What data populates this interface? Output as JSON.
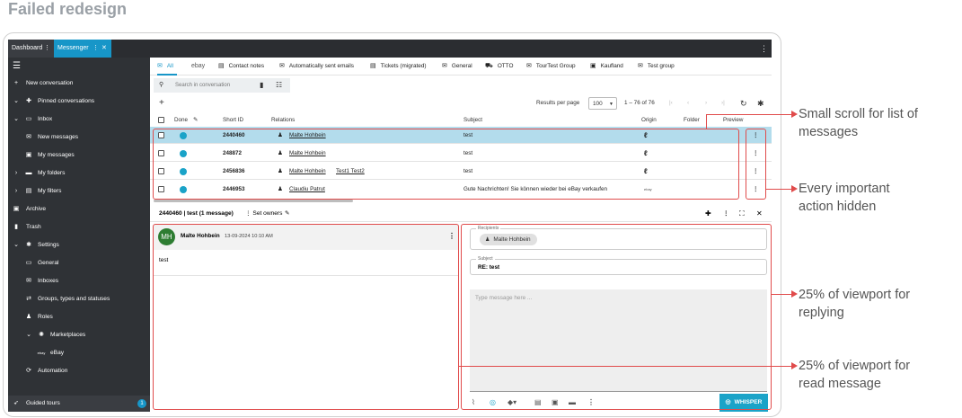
{
  "heading": "Failed redesign",
  "window_tabs": [
    {
      "label": "Dashboard",
      "menu": "⋮"
    },
    {
      "label": "Messenger",
      "menu": "⋮",
      "close": "✕"
    }
  ],
  "window_menu": "⋮",
  "sidebar": {
    "menu_icon": "hamburger-icon",
    "items": [
      {
        "label": "New conversation",
        "icon": "plus-icon"
      },
      {
        "label": "Pinned conversations",
        "icon": "pin-icon",
        "chevron": "⌄"
      },
      {
        "label": "Inbox",
        "icon": "inbox-icon",
        "chevron": "⌄"
      },
      {
        "label": "New messages",
        "icon": "mail-icon"
      },
      {
        "label": "My messages",
        "icon": "person-inbox-icon"
      },
      {
        "label": "My folders",
        "icon": "folder-icon",
        "chevron": "›"
      },
      {
        "label": "My filters",
        "icon": "filter-icon",
        "chevron": "›"
      },
      {
        "label": "Archive",
        "icon": "archive-icon"
      },
      {
        "label": "Trash",
        "icon": "trash-icon"
      },
      {
        "label": "Settings",
        "icon": "gear-icon",
        "chevron": "⌄"
      },
      {
        "label": "General",
        "icon": "window-icon"
      },
      {
        "label": "Inboxes",
        "icon": "mail-icon"
      },
      {
        "label": "Groups, types and statuses",
        "icon": "shuffle-icon"
      },
      {
        "label": "Roles",
        "icon": "people-icon"
      },
      {
        "label": "Marketplaces",
        "icon": "marketplace-icon",
        "chevron": "⌄"
      },
      {
        "label": "eBay",
        "icon": "ebay-icon"
      },
      {
        "label": "Automation",
        "icon": "automation-icon"
      }
    ],
    "guided_tours": "Guided tours",
    "guided_tours_badge": "1"
  },
  "inbox_tabs": [
    {
      "label": "All",
      "icon": "mail-icon"
    },
    {
      "label": "ebay",
      "icon": "ebay-logo"
    },
    {
      "label": "Contact notes",
      "icon": "note-icon"
    },
    {
      "label": "Automatically sent emails",
      "icon": "mail-icon"
    },
    {
      "label": "Tickets (migrated)",
      "icon": "list-icon"
    },
    {
      "label": "General",
      "icon": "mail-icon"
    },
    {
      "label": "OTTO",
      "icon": "cart-icon"
    },
    {
      "label": "TourTest Group",
      "icon": "mail-icon"
    },
    {
      "label": "Kaufland",
      "icon": "kaufland-icon"
    },
    {
      "label": "Test group",
      "icon": "mail-icon"
    }
  ],
  "search": {
    "placeholder": "Search in conversation"
  },
  "pagination": {
    "add": "+",
    "results_label": "Results per page",
    "per_page": "100",
    "range": "1 – 76 of 76"
  },
  "table": {
    "columns": [
      "Done",
      "Short ID",
      "Relations",
      "Subject",
      "Origin",
      "Folder",
      "Preview"
    ],
    "rows": [
      {
        "id": "2440460",
        "relations": [
          "Malte Hohbein"
        ],
        "subject": "test",
        "origin": "eBay",
        "selected": true
      },
      {
        "id": "248872",
        "relations": [
          "Malte Hohbein"
        ],
        "subject": "test",
        "origin": "eBay",
        "selected": false
      },
      {
        "id": "2456836",
        "relations": [
          "Malte Hohbein",
          "Test1 Test2"
        ],
        "subject": "test",
        "origin": "eBay",
        "selected": false
      },
      {
        "id": "2446953",
        "relations": [
          "Claudiu Patrut"
        ],
        "subject": "Gute Nachrichten! Sie können wieder bei eBay verkaufen",
        "origin": "ebay",
        "selected": false
      }
    ]
  },
  "detail": {
    "title": "2440460 | test (1 message)",
    "set_owners": "⋮ Set owners"
  },
  "message": {
    "initials": "MH",
    "sender": "Malte Hohbein",
    "date": "13-09-2024 10:10 AM",
    "body": "test"
  },
  "reply": {
    "recipients_label": "Recipients",
    "recipient": "Malte Hohbein",
    "subject_label": "Subject",
    "subject": "RE: test",
    "placeholder": "Type message here ...",
    "send_label": "WHISPER"
  },
  "annotations": [
    {
      "text_lines": [
        "Small scroll for list of",
        "messages"
      ]
    },
    {
      "text_lines": [
        "Every important",
        "action hidden"
      ]
    },
    {
      "text_lines": [
        "25% of viewport for",
        "replying"
      ]
    },
    {
      "text_lines": [
        "25% of viewport for",
        "read message"
      ]
    }
  ],
  "colors": {
    "accent": "#1796c8",
    "selected_row": "#b3dcec",
    "sidebar": "#2f3236",
    "annotation": "#e04b4b"
  }
}
